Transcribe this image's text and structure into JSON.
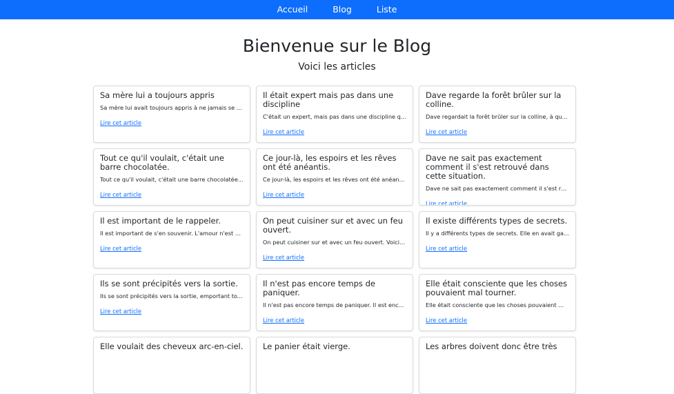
{
  "nav": {
    "items": [
      {
        "label": "Accueil"
      },
      {
        "label": "Blog"
      },
      {
        "label": "Liste"
      }
    ]
  },
  "hero": {
    "title": "Bienvenue sur le Blog",
    "subtitle": "Voici les articles"
  },
  "articles": [
    {
      "title": "Sa mère lui a toujours appris",
      "excerpt": "Sa mère lui avait toujours appris à ne jamais se c...",
      "link": "Lire cet article"
    },
    {
      "title": "Il était expert mais pas dans une discipline",
      "excerpt": "C'était un expert, mais pas dans une discipline q...",
      "link": "Lire cet article"
    },
    {
      "title": "Dave regarde la forêt brûler sur la colline.",
      "excerpt": "Dave regardait la forêt brûler sur la colline, à qu...",
      "link": "Lire cet article"
    },
    {
      "title": "Tout ce qu'il voulait, c'était une barre chocolatée.",
      "excerpt": "Tout ce qu'il voulait, c'était une barre chocolatée...",
      "link": "Lire cet article"
    },
    {
      "title": "Ce jour-là, les espoirs et les rêves ont été anéantis.",
      "excerpt": "Ce jour-là, les espoirs et les rêves ont été anéan...",
      "link": "Lire cet article"
    },
    {
      "title": "Dave ne sait pas exactement comment il s'est retrouvé dans cette situation.",
      "excerpt": "Dave ne sait pas exactement comment il s'est re...",
      "link": "Lire cet article"
    },
    {
      "title": "Il est important de le rappeler.",
      "excerpt": "Il est important de s'en souvenir. L'amour n'est p...",
      "link": "Lire cet article"
    },
    {
      "title": "On peut cuisiner sur et avec un feu ouvert.",
      "excerpt": "On peut cuisiner sur et avec un feu ouvert. Voici ...",
      "link": "Lire cet article"
    },
    {
      "title": "Il existe différents types de secrets.",
      "excerpt": "Il y a différents types de secrets. Elle en avait ga...",
      "link": "Lire cet article"
    },
    {
      "title": "Ils se sont précipités vers la sortie.",
      "excerpt": "Ils se sont précipités vers la sortie, emportant to...",
      "link": "Lire cet article"
    },
    {
      "title": "Il n'est pas encore temps de paniquer.",
      "excerpt": "Il n'est pas encore temps de paniquer. Il est enc...",
      "link": "Lire cet article"
    },
    {
      "title": "Elle était consciente que les choses pouvaient mal tourner.",
      "excerpt": "Elle était consciente que les choses pouvaient ...",
      "link": "Lire cet article"
    },
    {
      "title": "Elle voulait des cheveux arc-en-ciel.",
      "excerpt": "",
      "link": ""
    },
    {
      "title": "Le panier était vierge.",
      "excerpt": "",
      "link": ""
    },
    {
      "title": "Les arbres doivent donc être très",
      "excerpt": "",
      "link": ""
    }
  ]
}
